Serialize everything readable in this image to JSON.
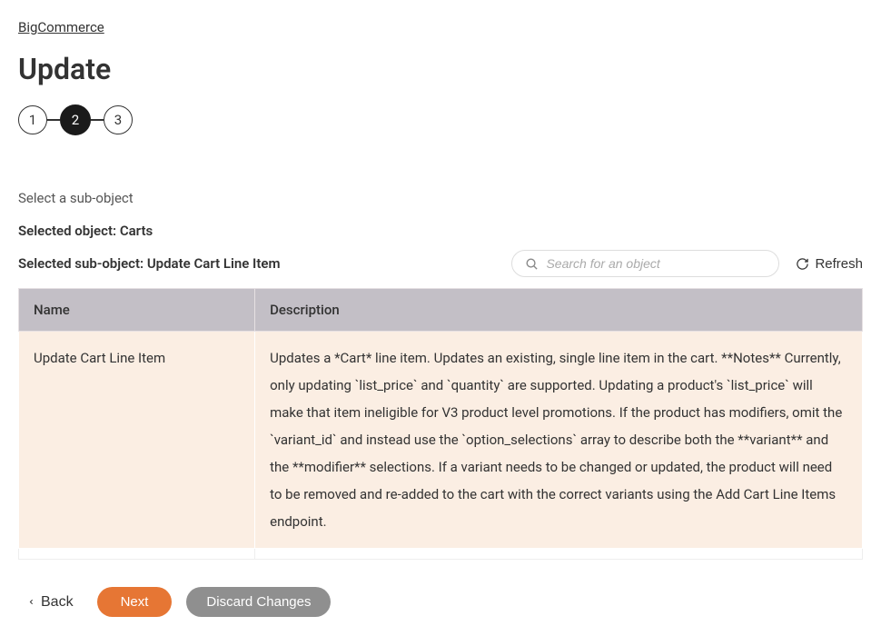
{
  "breadcrumb": "BigCommerce",
  "page_title": "Update",
  "stepper": {
    "steps": [
      "1",
      "2",
      "3"
    ],
    "active_index": 1
  },
  "subheader": "Select a sub-object",
  "selected_object": {
    "label": "Selected object: ",
    "value": "Carts"
  },
  "selected_sub_object": {
    "label": "Selected sub-object: ",
    "value": "Update Cart Line Item"
  },
  "search": {
    "placeholder": "Search for an object"
  },
  "refresh_label": "Refresh",
  "table": {
    "headers": {
      "name": "Name",
      "description": "Description"
    },
    "row": {
      "name": "Update Cart Line Item",
      "description": "Updates a *Cart* line item. Updates an existing, single line item in the cart. **Notes** Currently, only updating `list_price` and `quantity` are supported. Updating a product's `list_price` will make that item ineligible for V3 product level promotions. If the product has modifiers, omit the `variant_id` and instead use the `option_selections` array to describe both the **variant** and the **modifier** selections. If a variant needs to be changed or updated, the product will need to be removed and re-added to the cart with the correct variants using the Add Cart Line Items endpoint."
    }
  },
  "footer": {
    "back": "Back",
    "next": "Next",
    "discard": "Discard Changes"
  }
}
